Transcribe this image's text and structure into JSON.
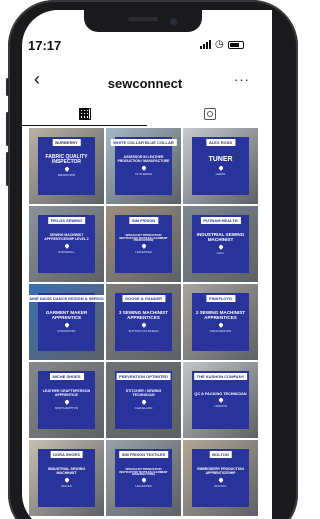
{
  "status_bar": {
    "time": "17:17"
  },
  "header": {
    "title": "sewconnect",
    "back_icon": "chevron-left-icon",
    "more_icon": "more-icon"
  },
  "tabs": [
    {
      "name": "posts-grid",
      "icon": "grid-icon",
      "active": true
    },
    {
      "name": "tagged",
      "icon": "tagged-user-icon",
      "active": false
    }
  ],
  "posts": [
    {
      "tag": "BURBERRY",
      "title": "FABRIC QUALITY INSPECTOR",
      "location": "Bradford",
      "size": 5,
      "bg": "#b9b1a5"
    },
    {
      "tag": "WHITE COLLAR BLUE COLLAR",
      "title": "ASSESSOR IN LEATHER PRODUCTION / MANUFACTURE",
      "location": "Clitheroe",
      "size": 3.4,
      "bg": "#a4b6c6"
    },
    {
      "tag": "ALEX ROSS",
      "title": "TUNER",
      "location": "Leeds",
      "size": 7,
      "bg": "#c6cbcf"
    },
    {
      "tag": "FIELDS SEWING",
      "title": "SEWING MACHINIST APPRENTICESHIP LEVEL 2",
      "location": "Cornwall",
      "size": 3.4,
      "bg": "#8c939a"
    },
    {
      "tag": "SIM FRISON",
      "title": "SPECIALIST PRODUCTION INSTRUCTOR TEXTILES (GARMENT PRODUCTION)",
      "location": "Leicester",
      "size": 2.8,
      "bg": "#9c8f7e"
    },
    {
      "tag": "PUTNAM HEALTH",
      "title": "INDUSTRIAL SEWING MACHINIST",
      "location": "Hull",
      "size": 4.6,
      "bg": "#7e8790"
    },
    {
      "tag": "ELAINE DAVIS DANCE DESIGN & SERVICES",
      "title": "GARMENT MAKER APPRENTICE",
      "location": "Stockport",
      "size": 4.6,
      "bg": "#3b6fb0"
    },
    {
      "tag": "GOOSE & GANDER",
      "title": "3 SEWING MACHINIST APPRENTICES",
      "location": "Sutton Coldfield",
      "size": 4.6,
      "bg": "#7f7d7a"
    },
    {
      "tag": "PINKFLOYD",
      "title": "2 SEWING MACHINIST APPRENTICES",
      "location": "Manchester",
      "size": 4.6,
      "bg": "#a9a39c"
    },
    {
      "tag": "MICHE SHOES",
      "title": "LEATHER CRAFTSPERSON APPRENTICE",
      "location": "Northampton",
      "size": 3.6,
      "bg": "#868a8d"
    },
    {
      "tag": "PREVENTION OPTIMITED",
      "title": "STITCHER / SEWING TECHNICIAN",
      "location": "Cleveland",
      "size": 3.6,
      "bg": "#6d7075"
    },
    {
      "tag": "THE KUSHON COMPANY",
      "title": "QC & PACKING TECHNICIAN",
      "location": "London",
      "size": 3.8,
      "bg": "#c2c5c8"
    },
    {
      "tag": "DORA SHOES",
      "title": "INDUSTRIAL SEWING MACHINIST",
      "location": "Wales",
      "size": 3.6,
      "bg": "#c8bfb2"
    },
    {
      "tag": "SIM FRISON TEXTILES",
      "title": "SPECIALIST PRODUCTION INSTRUCTOR TEXTILES (GARMENT MANUFACTURE)",
      "location": "Leicester",
      "size": 2.8,
      "bg": "#9aa0a6"
    },
    {
      "tag": "BOLTON",
      "title": "EMBROIDERY PRODUCTION APPRENTICESHIP",
      "location": "Bolton",
      "size": 3.4,
      "bg": "#b3a795"
    }
  ]
}
